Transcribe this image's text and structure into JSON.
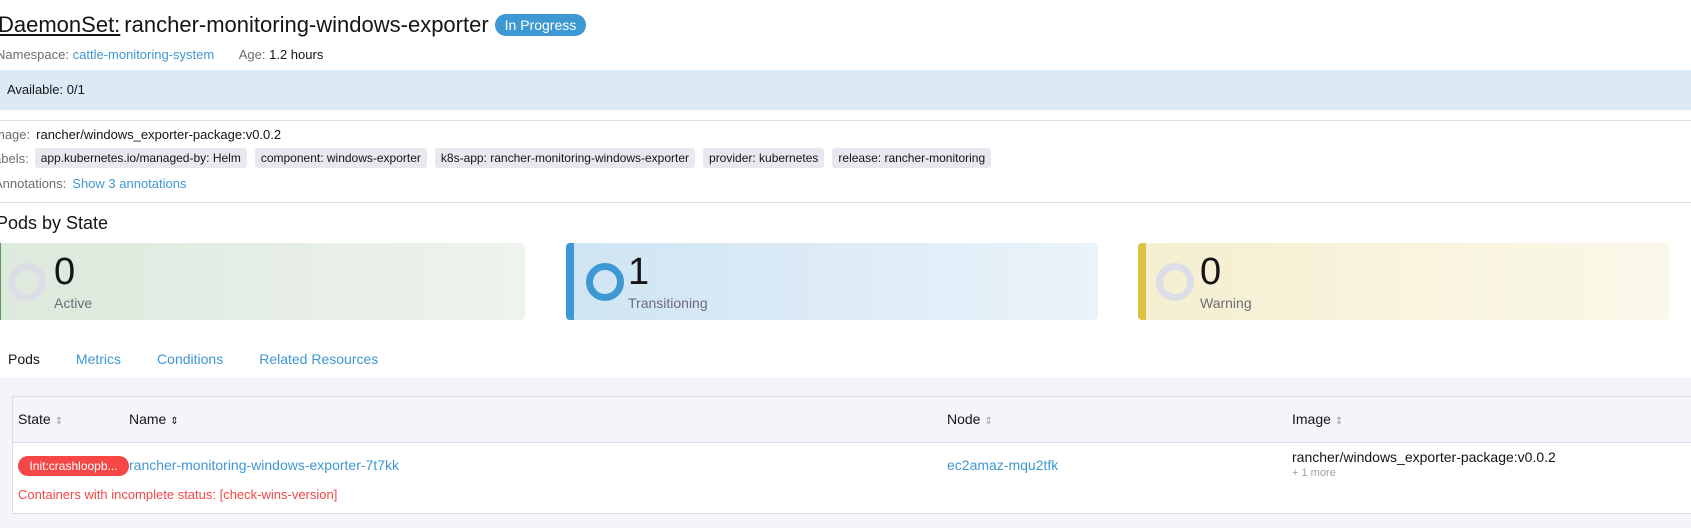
{
  "header": {
    "resource_type": "DaemonSet:",
    "name": "rancher-monitoring-windows-exporter",
    "status": "In Progress",
    "namespace_label": "Namespace:",
    "namespace": "cattle-monitoring-system",
    "age_label": "Age:",
    "age": "1.2 hours"
  },
  "availability": "Available: 0/1",
  "details": {
    "image_label": "mage:",
    "image": "rancher/windows_exporter-package:v0.0.2",
    "labels_label": "abels:",
    "labels": [
      "app.kubernetes.io/managed-by: Helm",
      "component: windows-exporter",
      "k8s-app: rancher-monitoring-windows-exporter",
      "provider: kubernetes",
      "release: rancher-monitoring"
    ],
    "annotations_label": "Annotations:",
    "annotations_link": "Show 3 annotations"
  },
  "pods_by_state": {
    "title": "Pods by State",
    "cards": [
      {
        "count": "0",
        "label": "Active"
      },
      {
        "count": "1",
        "label": "Transitioning"
      },
      {
        "count": "0",
        "label": "Warning"
      }
    ]
  },
  "tabs": [
    "Pods",
    "Metrics",
    "Conditions",
    "Related Resources"
  ],
  "table": {
    "columns": [
      "State",
      "Name",
      "Node",
      "Image"
    ],
    "rows": [
      {
        "state": "Init:crashloopb...",
        "name": "rancher-monitoring-windows-exporter-7t7kk",
        "node": "ec2amaz-mqu2tfk",
        "image": "rancher/windows_exporter-package:v0.0.2",
        "image_more": "+ 1 more",
        "error": "Containers with incomplete status: [check-wins-version]"
      }
    ]
  },
  "colors": {
    "accent": "#3d98d3",
    "active": "#5d995d",
    "warning": "#dac342",
    "error": "#f64747"
  }
}
